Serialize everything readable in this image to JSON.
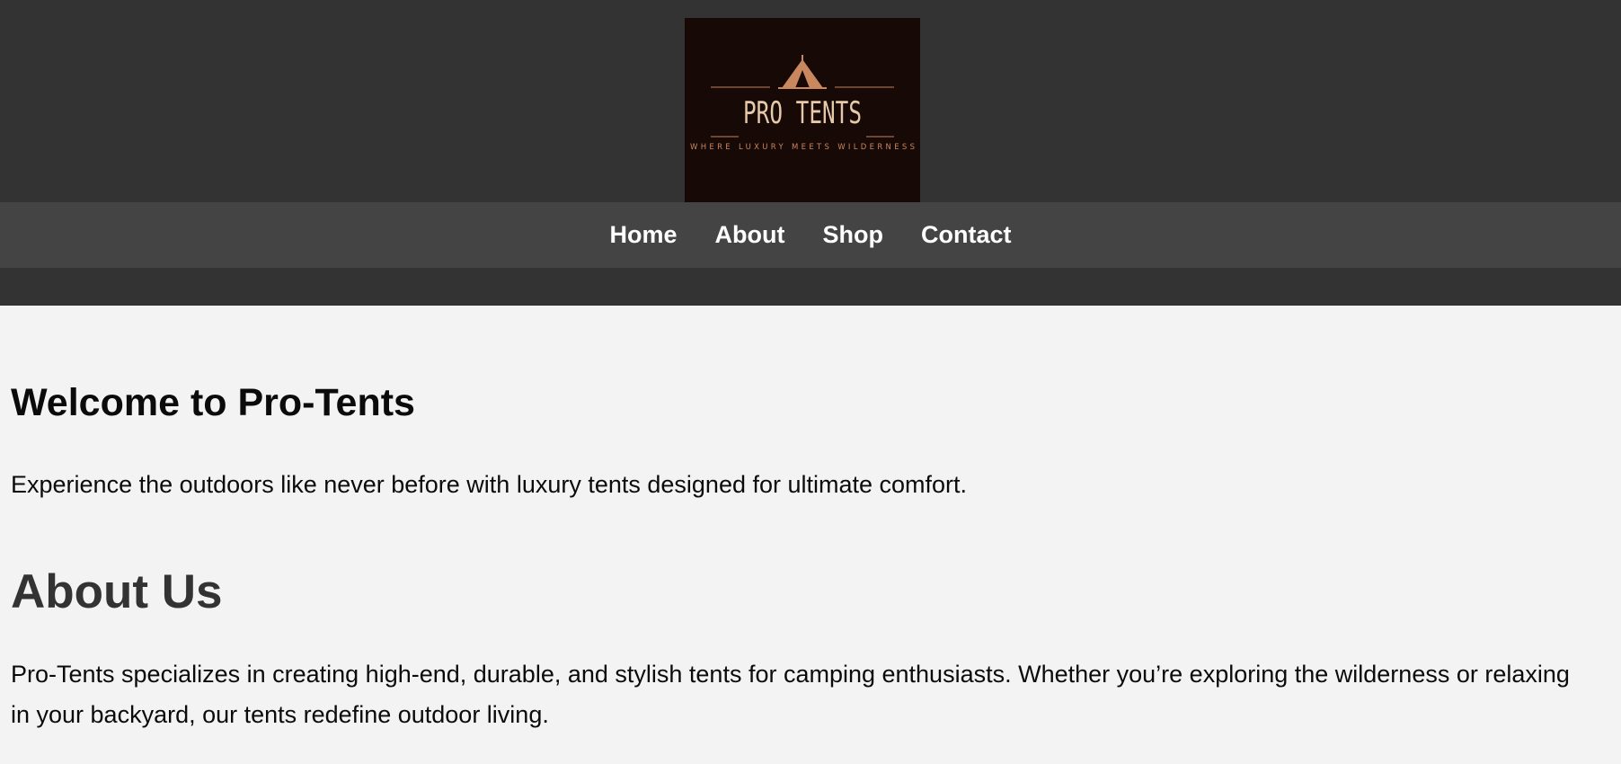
{
  "logo": {
    "title": "PRO TENTS",
    "tagline": "WHERE LUXURY MEETS WILDERNESS",
    "accent_color": "#c9875d",
    "text_color": "#e6c9a8",
    "background": "#170906"
  },
  "nav": {
    "items": [
      {
        "label": "Home"
      },
      {
        "label": "About"
      },
      {
        "label": "Shop"
      },
      {
        "label": "Contact"
      }
    ]
  },
  "hero": {
    "title": "Welcome to Pro-Tents",
    "text": "Experience the outdoors like never before with luxury tents designed for ultimate comfort."
  },
  "about": {
    "title": "About Us",
    "text": "Pro-Tents specializes in creating high-end, durable, and stylish tents for camping enthusiasts. Whether you’re exploring the wilderness or relaxing in your backyard, our tents redefine outdoor living."
  },
  "colors": {
    "header_bg": "#333333",
    "nav_bg": "#444444",
    "page_bg": "#f3f3f3"
  }
}
